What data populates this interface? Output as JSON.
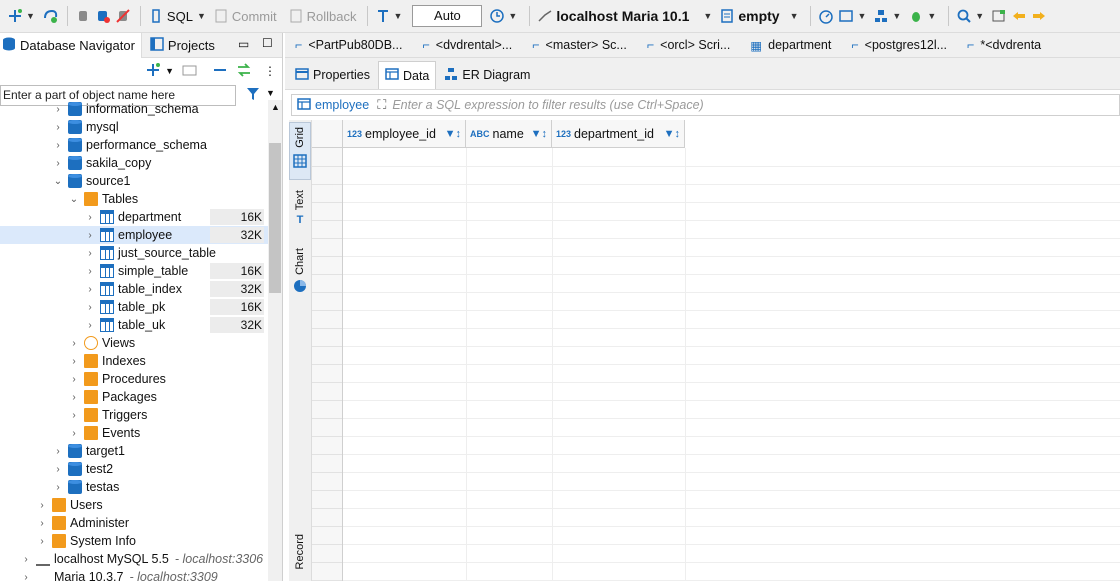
{
  "toolbar": {
    "sql_label": "SQL",
    "commit_label": "Commit",
    "rollback_label": "Rollback",
    "txn_mode": "Auto",
    "connection": "localhost Maria 10.1",
    "schema": "empty"
  },
  "left_panel": {
    "tabs": [
      "Database Navigator",
      "Projects"
    ],
    "filter_placeholder": "Enter a part of object name here"
  },
  "tree": [
    {
      "label": "information_schema",
      "level": 4,
      "icon": "database-icon",
      "arrow": ">",
      "size": ""
    },
    {
      "label": "mysql",
      "level": 4,
      "icon": "database-icon",
      "arrow": ">",
      "size": ""
    },
    {
      "label": "performance_schema",
      "level": 4,
      "icon": "database-icon",
      "arrow": ">",
      "size": ""
    },
    {
      "label": "sakila_copy",
      "level": 4,
      "icon": "database-icon",
      "arrow": ">",
      "size": ""
    },
    {
      "label": "source1",
      "level": 4,
      "icon": "database-icon",
      "arrow": "v",
      "size": ""
    },
    {
      "label": "Tables",
      "level": 5,
      "icon": "tables-folder-icon",
      "arrow": "v",
      "size": ""
    },
    {
      "label": "department",
      "level": 6,
      "icon": "table-icon",
      "arrow": ">",
      "size": "16K"
    },
    {
      "label": "employee",
      "level": 6,
      "icon": "table-icon",
      "arrow": ">",
      "size": "32K",
      "selected": true
    },
    {
      "label": "just_source_table",
      "level": 6,
      "icon": "table-icon",
      "arrow": ">",
      "size": ""
    },
    {
      "label": "simple_table",
      "level": 6,
      "icon": "table-icon",
      "arrow": ">",
      "size": "16K"
    },
    {
      "label": "table_index",
      "level": 6,
      "icon": "table-icon",
      "arrow": ">",
      "size": "32K"
    },
    {
      "label": "table_pk",
      "level": 6,
      "icon": "table-icon",
      "arrow": ">",
      "size": "16K"
    },
    {
      "label": "table_uk",
      "level": 6,
      "icon": "table-icon",
      "arrow": ">",
      "size": "32K"
    },
    {
      "label": "Views",
      "level": 5,
      "icon": "views-icon",
      "arrow": ">",
      "size": ""
    },
    {
      "label": "Indexes",
      "level": 5,
      "icon": "folder-icon",
      "arrow": ">",
      "size": ""
    },
    {
      "label": "Procedures",
      "level": 5,
      "icon": "folder-icon",
      "arrow": ">",
      "size": ""
    },
    {
      "label": "Packages",
      "level": 5,
      "icon": "folder-icon",
      "arrow": ">",
      "size": ""
    },
    {
      "label": "Triggers",
      "level": 5,
      "icon": "folder-icon",
      "arrow": ">",
      "size": ""
    },
    {
      "label": "Events",
      "level": 5,
      "icon": "folder-icon",
      "arrow": ">",
      "size": ""
    },
    {
      "label": "target1",
      "level": 4,
      "icon": "database-icon",
      "arrow": ">",
      "size": ""
    },
    {
      "label": "test2",
      "level": 4,
      "icon": "database-icon",
      "arrow": ">",
      "size": ""
    },
    {
      "label": "testas",
      "level": 4,
      "icon": "database-icon",
      "arrow": ">",
      "size": ""
    },
    {
      "label": "Users",
      "level": 3,
      "icon": "users-icon",
      "arrow": ">",
      "size": ""
    },
    {
      "label": "Administer",
      "level": 3,
      "icon": "administer-icon",
      "arrow": ">",
      "size": ""
    },
    {
      "label": "System Info",
      "level": 3,
      "icon": "system-info-icon",
      "arrow": ">",
      "size": ""
    },
    {
      "label": "localhost MySQL 5.5",
      "level": 2,
      "icon": "connection-icon",
      "arrow": ">",
      "size": "",
      "host": "- localhost:3306"
    },
    {
      "label": "Maria 10.3.7",
      "level": 2,
      "icon": "connection-icon",
      "arrow": ">",
      "size": "",
      "host": "- localhost:3309"
    }
  ],
  "editor_tabs": [
    "<PartPub80DB...",
    "<dvdrental>...",
    "<master> Sc...",
    "<orcl> Scri...",
    "department",
    "<postgres12l...",
    "*<dvdrenta"
  ],
  "sub_tabs": [
    "Properties",
    "Data",
    "ER Diagram"
  ],
  "filter_bar": {
    "table": "employee",
    "placeholder": "Enter a SQL expression to filter results (use Ctrl+Space)"
  },
  "side_tabs": [
    "Grid",
    "Text",
    "Chart",
    "Record"
  ],
  "grid": {
    "columns": [
      {
        "type": "123",
        "name": "employee_id"
      },
      {
        "type": "ABC",
        "name": "name"
      },
      {
        "type": "123",
        "name": "department_id"
      }
    ]
  },
  "colors": {
    "accent": "#1d6fbf",
    "folder": "#f29a1c",
    "selection": "#dbe9fb"
  }
}
